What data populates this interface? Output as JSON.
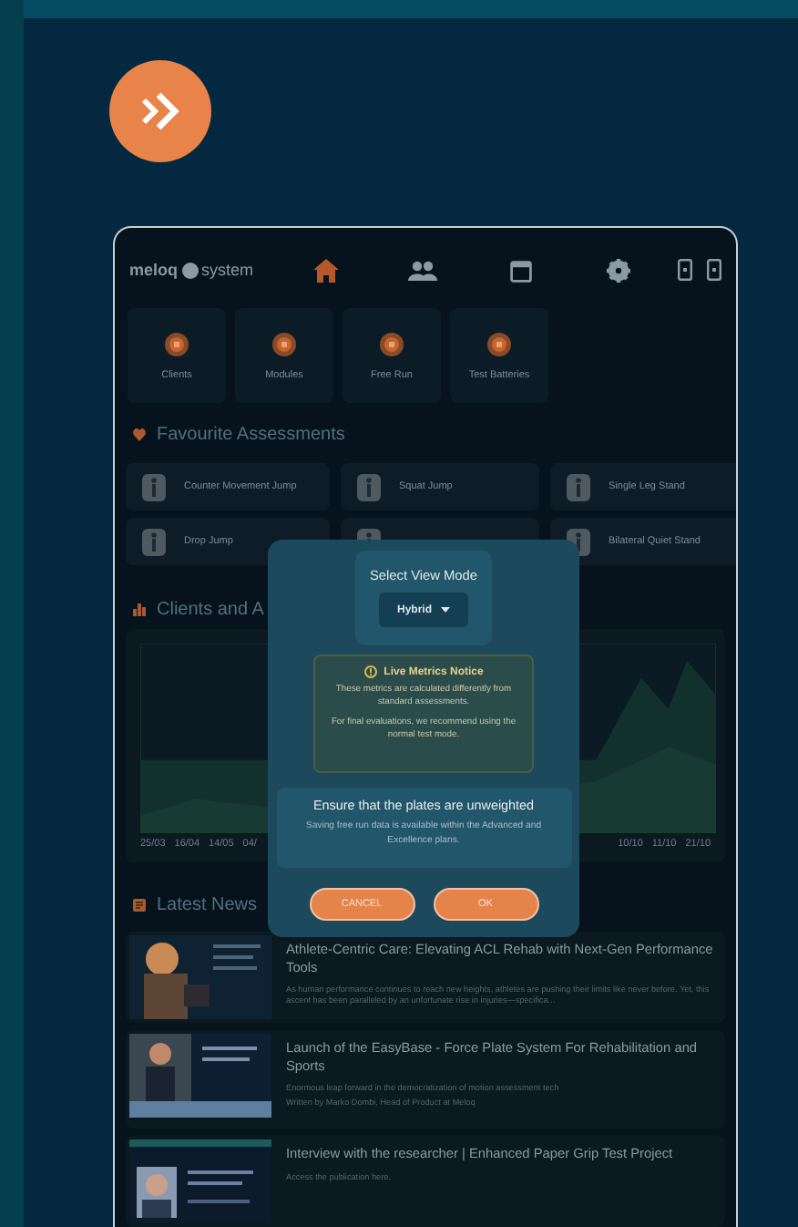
{
  "logo": {
    "left": "meloq",
    "right": "system"
  },
  "nav": [
    {
      "kind": "home",
      "selected": true
    },
    {
      "kind": "people",
      "selected": false
    },
    {
      "kind": "calendar",
      "selected": false
    },
    {
      "kind": "settings",
      "selected": false
    },
    {
      "kind": "device",
      "selected": false
    },
    {
      "kind": "device",
      "selected": false
    }
  ],
  "tiles": [
    {
      "label": "Clients"
    },
    {
      "label": "Modules"
    },
    {
      "label": "Free Run"
    },
    {
      "label": "Test Batteries"
    }
  ],
  "favourites": {
    "title": "Favourite Assessments",
    "items": [
      {
        "kind": "card",
        "label": "Counter Movement Jump"
      },
      {
        "kind": "card",
        "label": "Squat Jump"
      },
      {
        "kind": "card",
        "label": "Single Leg Stand"
      },
      {
        "kind": "card",
        "label": "Drop Jump"
      },
      {
        "kind": "card"
      },
      {
        "kind": "card",
        "label": "Bilateral Quiet Stand"
      }
    ]
  },
  "clients_chart": {
    "title": "Clients and A",
    "x_labels_start": [
      "25/03",
      "16/04",
      "14/05",
      "04/"
    ],
    "x_labels_end": [
      "10/10",
      "11/10",
      "21/10"
    ]
  },
  "news": {
    "title": "Latest News",
    "items": [
      {
        "title": "Athlete-Centric Care: Elevating ACL Rehab with Next-Gen Performance Tools",
        "lines": [
          "As human performance continues to reach new heights, athletes are pushing their limits like never before. Yet, this ascent has been paralleled by an unfortunate rise in injuries—specifica..."
        ]
      },
      {
        "title": "Launch of the EasyBase - Force Plate System For Rehabilitation and Sports",
        "lines": [
          "Enormous leap forward in the democratization of motion assessment tech",
          "Written by Marko Dombi, Head of Product at Meloq"
        ]
      },
      {
        "title": "Interview with the researcher | Enhanced Paper Grip Test Project",
        "lines": [
          "Access the publication here."
        ]
      }
    ]
  },
  "dialog": {
    "title": "Select View Mode",
    "mode": "Hybrid",
    "notice": {
      "title": "Live Metrics Notice",
      "paragraphs": [
        "These metrics are calculated differently from standard assessments.",
        "For final evaluations, we recommend using the normal test mode."
      ]
    },
    "info": {
      "title": "Ensure that the plates are unweighted",
      "text": "Saving free run data is available within the Advanced and Excellence plans."
    },
    "buttons": [
      "CANCEL",
      "OK"
    ]
  }
}
